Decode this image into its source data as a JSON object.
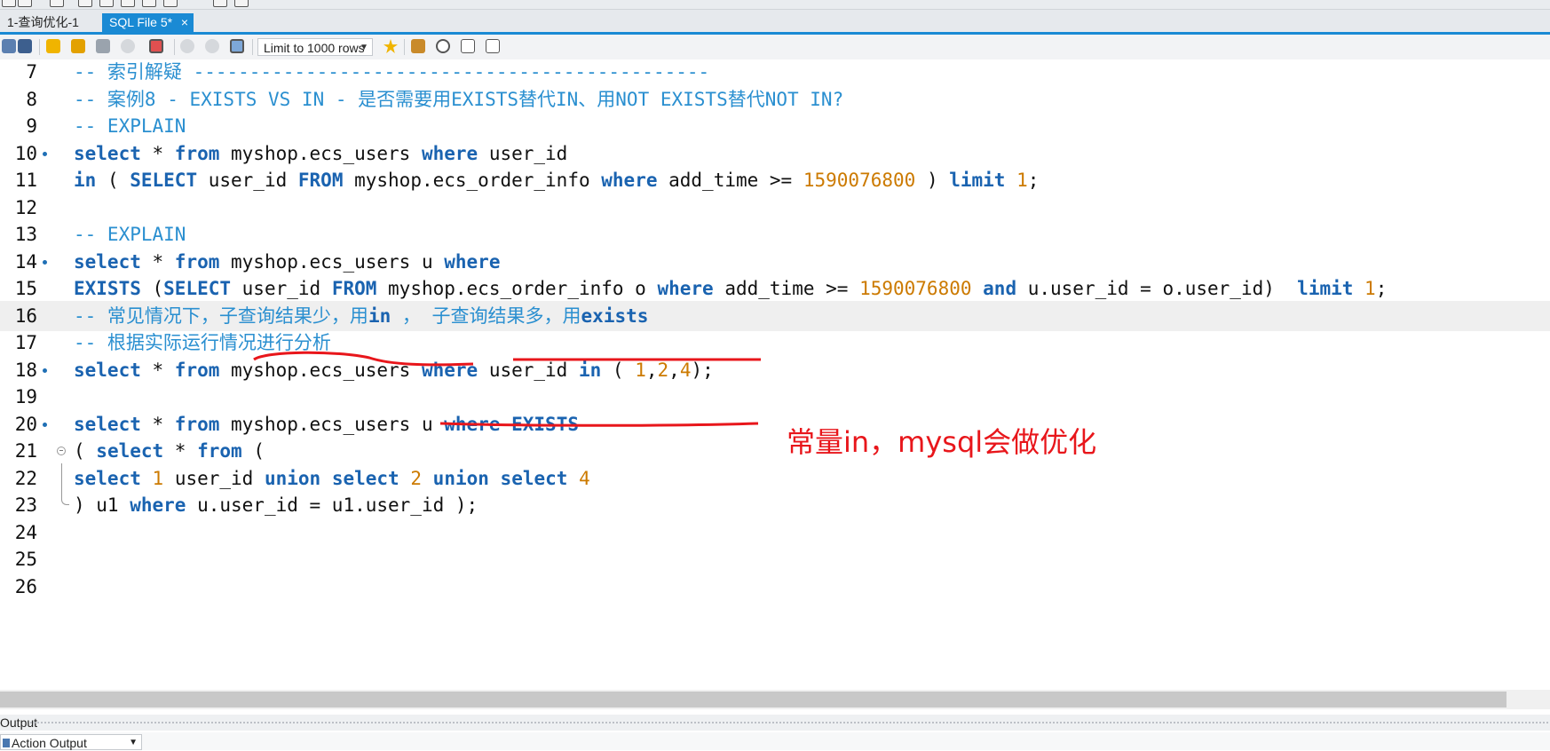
{
  "tabs": [
    {
      "label": "1-查询优化-1",
      "active": false
    },
    {
      "label": "SQL File 5*",
      "active": true,
      "close": "×"
    }
  ],
  "toolbar": {
    "limit_select": "Limit to 1000 rows",
    "icons": [
      "open-icon",
      "save-icon",
      "execute-icon",
      "execute-current-icon",
      "explain-icon",
      "stop-icon",
      "toggle-continue-icon",
      "commit-icon",
      "rollback-icon",
      "autocommit-icon",
      "bookmark-icon",
      "beautify-icon",
      "find-icon",
      "invisible-chars-icon",
      "wrap-icon"
    ]
  },
  "editor": {
    "lines": [
      {
        "n": "7",
        "tokens": [
          {
            "t": "com",
            "v": "-- 索引解疑 ----------------------------------------------"
          }
        ]
      },
      {
        "n": "8",
        "tokens": [
          {
            "t": "com",
            "v": "-- 案例8 - EXISTS VS IN - 是否需要用EXISTS替代IN、用NOT EXISTS替代NOT IN?"
          }
        ]
      },
      {
        "n": "9",
        "tokens": [
          {
            "t": "com",
            "v": "-- EXPLAIN"
          }
        ]
      },
      {
        "n": "10",
        "bullet": true,
        "tokens": [
          {
            "t": "kw",
            "v": "select"
          },
          {
            "t": "id",
            "v": " * "
          },
          {
            "t": "kw",
            "v": "from"
          },
          {
            "t": "id",
            "v": " myshop.ecs_users "
          },
          {
            "t": "kw",
            "v": "where"
          },
          {
            "t": "id",
            "v": " user_id"
          }
        ]
      },
      {
        "n": "11",
        "tokens": [
          {
            "t": "kw",
            "v": "in"
          },
          {
            "t": "id",
            "v": " ( "
          },
          {
            "t": "kw",
            "v": "SELECT"
          },
          {
            "t": "id",
            "v": " user_id "
          },
          {
            "t": "kw",
            "v": "FROM"
          },
          {
            "t": "id",
            "v": " myshop.ecs_order_info "
          },
          {
            "t": "kw",
            "v": "where"
          },
          {
            "t": "id",
            "v": " add_time >= "
          },
          {
            "t": "num",
            "v": "1590076800"
          },
          {
            "t": "id",
            "v": " ) "
          },
          {
            "t": "kw",
            "v": "limit"
          },
          {
            "t": "id",
            "v": " "
          },
          {
            "t": "num",
            "v": "1"
          },
          {
            "t": "id",
            "v": ";"
          }
        ]
      },
      {
        "n": "12",
        "tokens": []
      },
      {
        "n": "13",
        "tokens": [
          {
            "t": "com",
            "v": "-- EXPLAIN"
          }
        ]
      },
      {
        "n": "14",
        "bullet": true,
        "tokens": [
          {
            "t": "kw",
            "v": "select"
          },
          {
            "t": "id",
            "v": " * "
          },
          {
            "t": "kw",
            "v": "from"
          },
          {
            "t": "id",
            "v": " myshop.ecs_users u "
          },
          {
            "t": "kw",
            "v": "where"
          }
        ]
      },
      {
        "n": "15",
        "tokens": [
          {
            "t": "kw",
            "v": "EXISTS"
          },
          {
            "t": "id",
            "v": " ("
          },
          {
            "t": "kw",
            "v": "SELECT"
          },
          {
            "t": "id",
            "v": " user_id "
          },
          {
            "t": "kw",
            "v": "FROM"
          },
          {
            "t": "id",
            "v": " myshop.ecs_order_info o "
          },
          {
            "t": "kw",
            "v": "where"
          },
          {
            "t": "id",
            "v": " add_time >= "
          },
          {
            "t": "num",
            "v": "1590076800"
          },
          {
            "t": "id",
            "v": " "
          },
          {
            "t": "kw",
            "v": "and"
          },
          {
            "t": "id",
            "v": " u.user_id = o.user_id)  "
          },
          {
            "t": "kw",
            "v": "limit"
          },
          {
            "t": "id",
            "v": " "
          },
          {
            "t": "num",
            "v": "1"
          },
          {
            "t": "id",
            "v": ";"
          }
        ]
      },
      {
        "n": "16",
        "highlight": true,
        "tokens": [
          {
            "t": "com",
            "v": "-- 常见情况下，子查询结果少，用"
          },
          {
            "t": "kw",
            "v": "in"
          },
          {
            "t": "com",
            "v": " ， 子查询结果多，用"
          },
          {
            "t": "kw",
            "v": "exists"
          }
        ]
      },
      {
        "n": "17",
        "tokens": [
          {
            "t": "com",
            "v": "-- 根据实际运行情况进行分析"
          }
        ]
      },
      {
        "n": "18",
        "bullet": true,
        "tokens": [
          {
            "t": "kw",
            "v": "select"
          },
          {
            "t": "id",
            "v": " * "
          },
          {
            "t": "kw",
            "v": "from"
          },
          {
            "t": "id",
            "v": " myshop.ecs_users "
          },
          {
            "t": "kw",
            "v": "where"
          },
          {
            "t": "id",
            "v": " user_id "
          },
          {
            "t": "kw",
            "v": "in"
          },
          {
            "t": "id",
            "v": " ( "
          },
          {
            "t": "num",
            "v": "1"
          },
          {
            "t": "id",
            "v": ","
          },
          {
            "t": "num",
            "v": "2"
          },
          {
            "t": "id",
            "v": ","
          },
          {
            "t": "num",
            "v": "4"
          },
          {
            "t": "id",
            "v": ");"
          }
        ]
      },
      {
        "n": "19",
        "tokens": []
      },
      {
        "n": "20",
        "bullet": true,
        "tokens": [
          {
            "t": "kw",
            "v": "select"
          },
          {
            "t": "id",
            "v": " * "
          },
          {
            "t": "kw",
            "v": "from"
          },
          {
            "t": "id",
            "v": " myshop.ecs_users u "
          },
          {
            "t": "kw",
            "v": "where"
          },
          {
            "t": "id",
            "v": " "
          },
          {
            "t": "kw",
            "v": "EXISTS"
          }
        ]
      },
      {
        "n": "21",
        "fold": "start",
        "tokens": [
          {
            "t": "id",
            "v": "( "
          },
          {
            "t": "kw",
            "v": "select"
          },
          {
            "t": "id",
            "v": " * "
          },
          {
            "t": "kw",
            "v": "from"
          },
          {
            "t": "id",
            "v": " ("
          }
        ]
      },
      {
        "n": "22",
        "fold": "mid",
        "tokens": [
          {
            "t": "kw",
            "v": "select"
          },
          {
            "t": "id",
            "v": " "
          },
          {
            "t": "num",
            "v": "1"
          },
          {
            "t": "id",
            "v": " user_id "
          },
          {
            "t": "kw",
            "v": "union"
          },
          {
            "t": "id",
            "v": " "
          },
          {
            "t": "kw",
            "v": "select"
          },
          {
            "t": "id",
            "v": " "
          },
          {
            "t": "num",
            "v": "2"
          },
          {
            "t": "id",
            "v": " "
          },
          {
            "t": "kw",
            "v": "union"
          },
          {
            "t": "id",
            "v": " "
          },
          {
            "t": "kw",
            "v": "select"
          },
          {
            "t": "id",
            "v": " "
          },
          {
            "t": "num",
            "v": "4"
          }
        ]
      },
      {
        "n": "23",
        "fold": "end",
        "tokens": [
          {
            "t": "id",
            "v": ") u1 "
          },
          {
            "t": "kw",
            "v": "where"
          },
          {
            "t": "id",
            "v": " u.user_id = u1.user_id );"
          }
        ]
      },
      {
        "n": "24",
        "tokens": []
      },
      {
        "n": "25",
        "tokens": []
      },
      {
        "n": "26",
        "tokens": []
      }
    ]
  },
  "annotation": {
    "text": "常量in，mysql会做优化",
    "color": "#e8161b"
  },
  "output": {
    "header": "Output",
    "select": "Action Output"
  },
  "colors": {
    "comment": "#2a8fd0",
    "keyword": "#1a63b0",
    "number": "#cc7a00",
    "tab_active": "#1a8ad4",
    "annotation": "#e8161b"
  }
}
